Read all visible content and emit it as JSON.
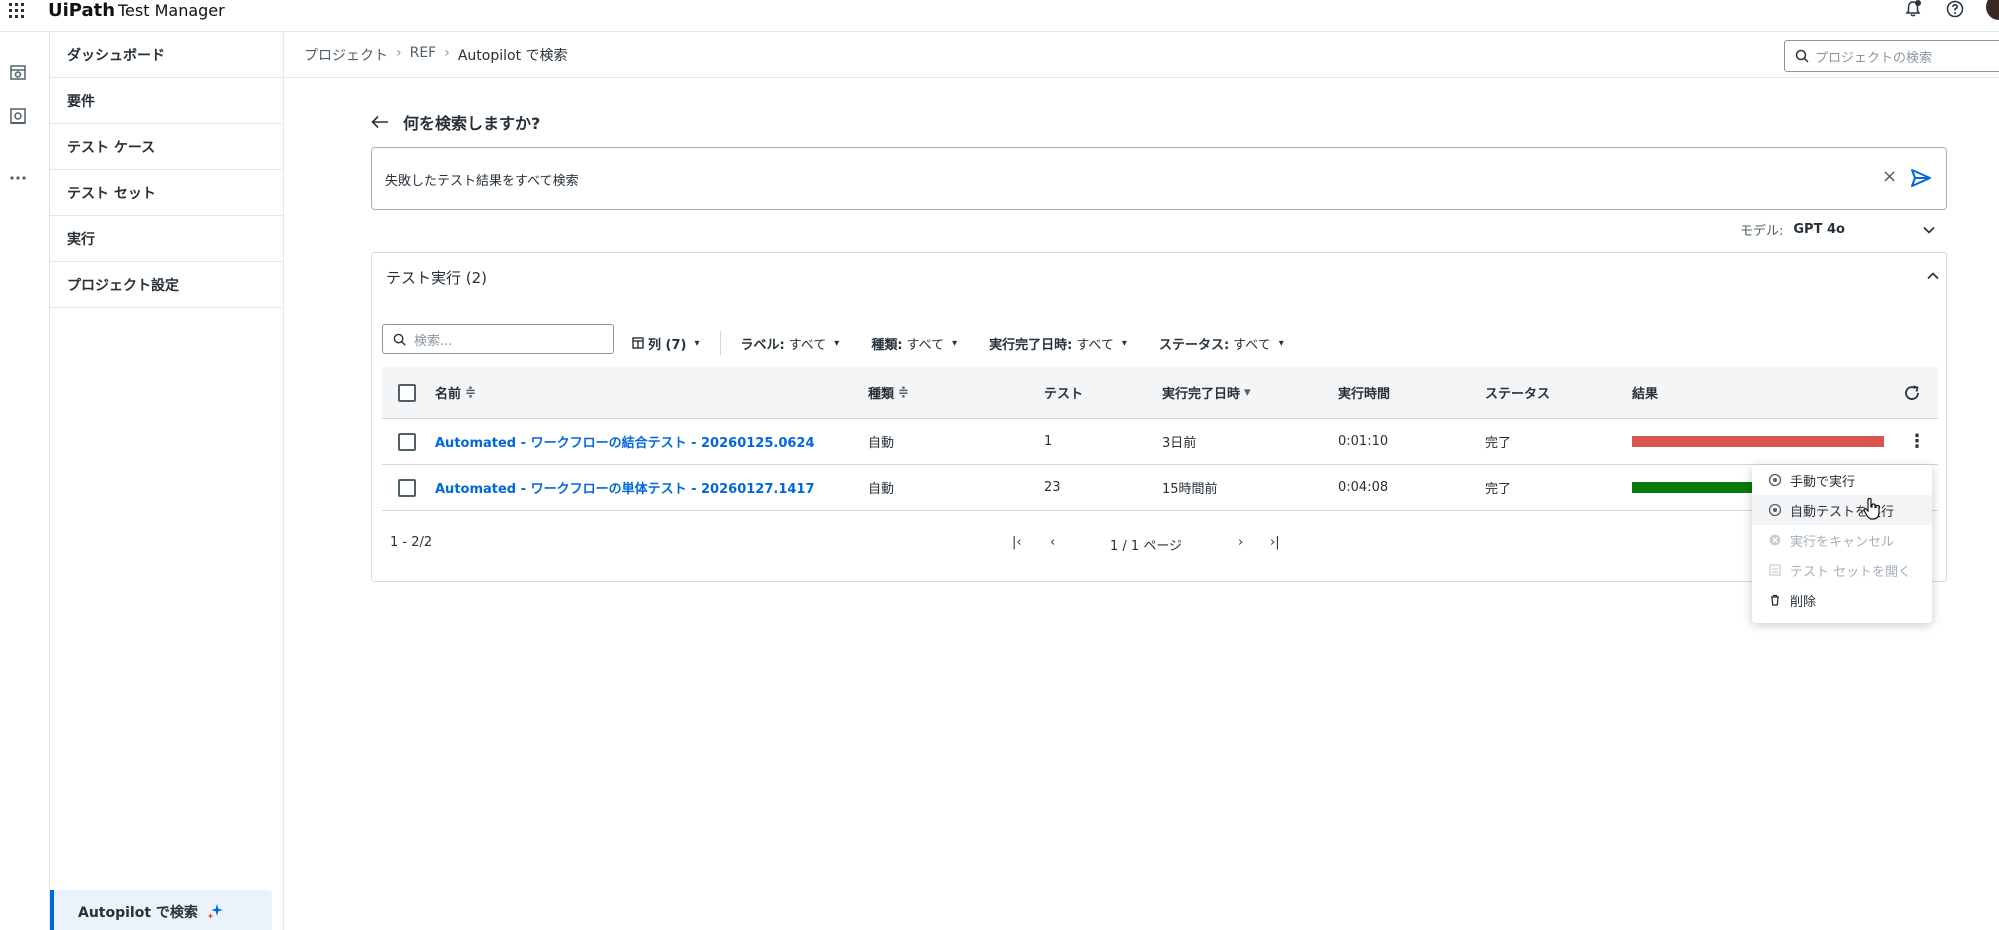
{
  "topbar": {
    "logo": "UiPath",
    "product": "Test Manager"
  },
  "sidebar": {
    "items": [
      {
        "label": "ダッシュボード"
      },
      {
        "label": "要件"
      },
      {
        "label": "テスト ケース"
      },
      {
        "label": "テスト セット"
      },
      {
        "label": "実行"
      },
      {
        "label": "プロジェクト設定"
      }
    ],
    "autopilot_label": "Autopilot で検索"
  },
  "breadcrumb": {
    "items": [
      "プロジェクト",
      "REF",
      "Autopilot で検索"
    ],
    "separator": "›"
  },
  "project_search": {
    "placeholder": "プロジェクトの検索"
  },
  "main": {
    "back_title": "何を検索しますか?",
    "query": "失敗したテスト結果をすべて検索",
    "clear": "×",
    "model_label": "モデル:",
    "model_value": "GPT 4o"
  },
  "results": {
    "title": "テスト実行 (2)",
    "search_placeholder": "検索...",
    "columns_button": "列 (7)",
    "filters": [
      {
        "key": "ラベル:",
        "value": "すべて"
      },
      {
        "key": "種類:",
        "value": "すべて"
      },
      {
        "key": "実行完了日時:",
        "value": "すべて"
      },
      {
        "key": "ステータス:",
        "value": "すべて"
      }
    ],
    "headers": {
      "name": "名前",
      "type": "種類",
      "tests": "テスト",
      "finished": "実行完了日時",
      "duration": "実行時間",
      "status": "ステータス",
      "result": "結果"
    },
    "sort_glyph": "≑",
    "sort_desc_glyph": "▾",
    "rows": [
      {
        "name": "Automated - ワークフローの結合テスト - 20260125.0624",
        "type": "自動",
        "tests": "1",
        "finished": "3日前",
        "duration": "0:01:10",
        "status": "完了",
        "result_color": "#d9534f",
        "kebab": "⋮"
      },
      {
        "name": "Automated - ワークフローの単体テスト - 20260127.1417",
        "type": "自動",
        "tests": "23",
        "finished": "15時間前",
        "duration": "0:04:08",
        "status": "完了",
        "result_color": "#0b7a0b",
        "kebab": ""
      }
    ],
    "pager": {
      "count": "1 - 2/2",
      "first": "|‹",
      "prev": "‹",
      "page": "1 / 1 ページ",
      "next": "›",
      "last": "›|"
    }
  },
  "context_menu": {
    "items": [
      {
        "label": "手動で実行",
        "icon": "play-circle-icon",
        "disabled": false
      },
      {
        "label": "自動テストを実行",
        "icon": "play-circle-icon",
        "disabled": false
      },
      {
        "label": "実行をキャンセル",
        "icon": "cancel-circle-icon",
        "disabled": true
      },
      {
        "label": "テスト セットを開く",
        "icon": "test-set-icon",
        "disabled": true
      },
      {
        "label": "削除",
        "icon": "trash-icon",
        "disabled": false
      }
    ]
  }
}
